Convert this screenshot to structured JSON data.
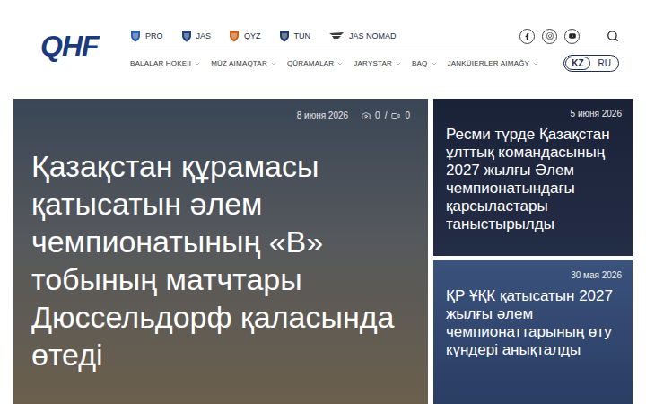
{
  "header": {
    "logo": "QHF",
    "brands": [
      {
        "label": "PRO",
        "kind": "shield",
        "color": "#2f5fa8"
      },
      {
        "label": "JAS",
        "kind": "shield",
        "color": "#1f3f7a"
      },
      {
        "label": "QYZ",
        "kind": "shield",
        "color": "#c8641e"
      },
      {
        "label": "TUN",
        "kind": "shield",
        "color": "#233a66"
      },
      {
        "label": "JAS NOMAD",
        "kind": "wing",
        "color": "#3a3a3a"
      }
    ],
    "menu": [
      "BALALAR HOKEII",
      "MÜZ AIMAQTAR",
      "QŪRAMALAR",
      "JARYSTAR",
      "BAQ",
      "JANKÜIERLER AIMAĞY"
    ],
    "languages": [
      {
        "label": "KZ",
        "selected": true
      },
      {
        "label": "RU",
        "selected": false
      }
    ]
  },
  "featured": {
    "date": "8 июня 2026",
    "photos": "0",
    "separator": "/",
    "videos": "0",
    "title": "Қазақстан құрамасы қатысатын әлем чемпионатының «B» тобының матчтары Дюссельдорф қаласында өтеді"
  },
  "news": [
    {
      "date": "5 июня 2026",
      "title": "Ресми түрде Қазақстан ұлттық командасының 2027 жылғы Әлем чемпионатындағы қарсыластары таныстырылды"
    },
    {
      "date": "30 мая 2026",
      "title": "ҚР ҰҚК қатысатын 2027 жылғы әлем чемпионаттарының өту күндері анықталды"
    }
  ]
}
